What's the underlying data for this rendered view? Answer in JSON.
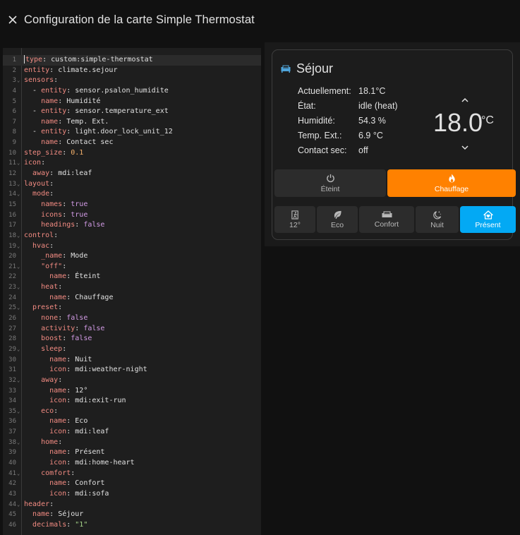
{
  "dialog": {
    "title": "Configuration de la carte Simple Thermostat"
  },
  "editor": {
    "lines": [
      "type: custom:simple-thermostat",
      "entity: climate.sejour",
      "sensors:",
      "  - entity: sensor.psalon_humidite",
      "    name: Humidité",
      "  - entity: sensor.temperature_ext",
      "    name: Temp. Ext.",
      "  - entity: light.door_lock_unit_12",
      "    name: Contact sec",
      "step_size: 0.1",
      "icon:",
      "  away: mdi:leaf",
      "layout:",
      "  mode:",
      "    names: true",
      "    icons: true",
      "    headings: false",
      "control:",
      "  hvac:",
      "    _name: Mode",
      "    \"off\":",
      "      name: Éteint",
      "    heat:",
      "      name: Chauffage",
      "  preset:",
      "    none: false",
      "    activity: false",
      "    boost: false",
      "    sleep:",
      "      name: Nuit",
      "      icon: mdi:weather-night",
      "    away:",
      "      name: 12°",
      "      icon: mdi:exit-run",
      "    eco:",
      "      name: Eco",
      "      icon: mdi:leaf",
      "    home:",
      "      name: Présent",
      "      icon: mdi:home-heart",
      "    comfort:",
      "      name: Confort",
      "      icon: mdi:sofa",
      "header:",
      "  name: Séjour",
      "  decimals: \"1\""
    ]
  },
  "card": {
    "header": {
      "name": "Séjour",
      "icon": "sofa-icon"
    },
    "sensors": [
      {
        "name": "Actuellement:",
        "value": "18.1°C"
      },
      {
        "name": "État:",
        "value": "idle (heat)"
      },
      {
        "name": "Humidité:",
        "value": "54.3 %"
      },
      {
        "name": "Temp. Ext.:",
        "value": "6.9 °C"
      },
      {
        "name": "Contact sec:",
        "value": "off"
      }
    ],
    "target": {
      "value": "18.0",
      "unit": "°C"
    },
    "hvac": [
      {
        "label": "Éteint",
        "icon": "power-icon",
        "active": false
      },
      {
        "label": "Chauffage",
        "icon": "fire-icon",
        "active": true
      }
    ],
    "presets": [
      {
        "label": "12°",
        "icon": "exit-run-icon",
        "active": false
      },
      {
        "label": "Eco",
        "icon": "leaf-icon",
        "active": false
      },
      {
        "label": "Confort",
        "icon": "sofa-icon",
        "active": false
      },
      {
        "label": "Nuit",
        "icon": "weather-night-icon",
        "active": false
      },
      {
        "label": "Présent",
        "icon": "home-heart-icon",
        "active": true
      }
    ],
    "colors": {
      "heat": "#ff8100",
      "preset_active": "#03a9f4",
      "header_icon": "#4fa3d9"
    }
  }
}
